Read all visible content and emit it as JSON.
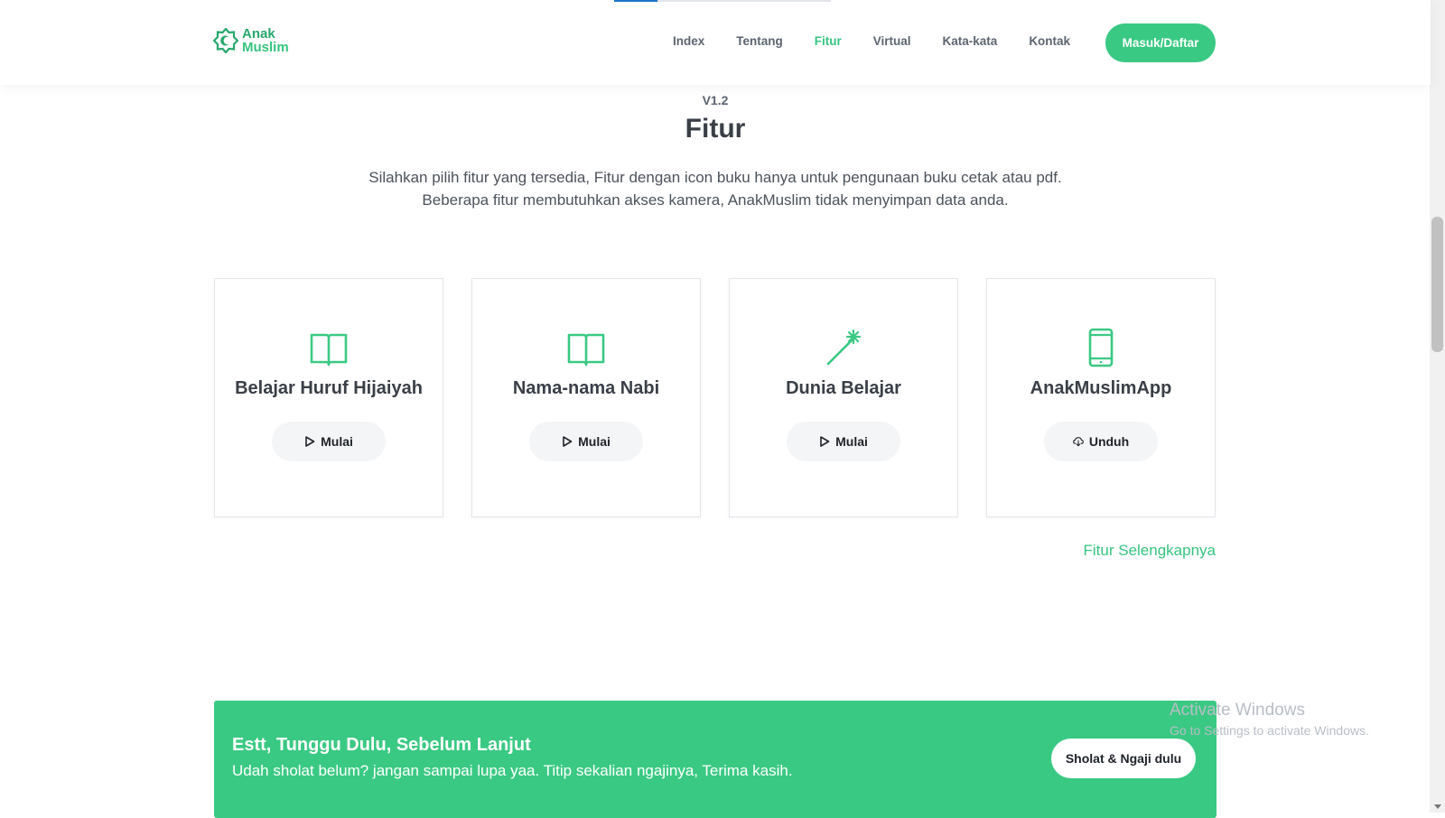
{
  "nav": {
    "logo": {
      "line1": "Anak",
      "line2": "Muslim"
    },
    "links": [
      "Index",
      "Tentang",
      "Fitur",
      "Virtual",
      "Kata-kata",
      "Kontak"
    ],
    "active_link": "Fitur",
    "login_label": "Masuk/Daftar"
  },
  "section": {
    "version": "V1.2",
    "title": "Fitur",
    "desc_line1": "Silahkan pilih fitur yang tersedia, Fitur dengan icon buku hanya untuk pengunaan buku cetak atau pdf.",
    "desc_line2": "Beberapa fitur membutuhkan akses kamera, AnakMuslim tidak menyimpan data anda."
  },
  "cards": [
    {
      "title": "Belajar Huruf Hijaiyah",
      "icon": "book-icon",
      "button": "Mulai",
      "button_icon": "play-icon"
    },
    {
      "title": "Nama-nama Nabi",
      "icon": "book-icon",
      "button": "Mulai",
      "button_icon": "play-icon"
    },
    {
      "title": "Dunia Belajar",
      "icon": "magic-wand-icon",
      "button": "Mulai",
      "button_icon": "play-icon"
    },
    {
      "title": "AnakMuslimApp",
      "icon": "phone-icon",
      "button": "Unduh",
      "button_icon": "cloud-download-icon"
    }
  ],
  "more_link": "Fitur Selengkapnya",
  "banner": {
    "title": "Estt, Tunggu Dulu, Sebelum Lanjut",
    "text": "Udah sholat belum? jangan sampai lupa yaa. Titip sekalian ngajinya, Terima kasih.",
    "button": "Sholat & Ngaji dulu"
  },
  "watermark": {
    "title": "Activate Windows",
    "subtitle": "Go to Settings to activate Windows."
  },
  "colors": {
    "accent": "#3ac983",
    "accent_text": "#35c47f",
    "text_dark": "#3a3f47",
    "nav_text": "#5c6470"
  }
}
